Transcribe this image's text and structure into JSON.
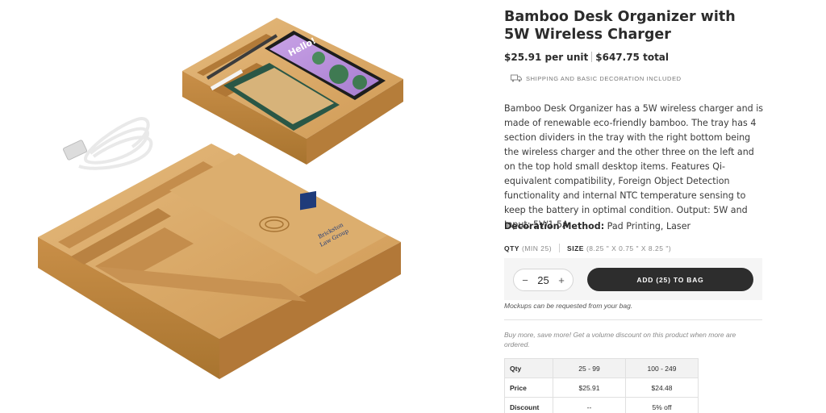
{
  "product": {
    "title": "Bamboo Desk Organizer with 5W Wireless Charger",
    "unit_price": "$25.91 per unit",
    "total_price": "$647.75 total",
    "shipping_note": "SHIPPING AND BASIC DECORATION INCLUDED",
    "description": "Bamboo Desk Organizer has a 5W wireless charger and is made of renewable eco-friendly bamboo. The tray has 4 section dividers in the tray with the right bottom being the wireless charger and the other three on the left and on the top hold small desktop items. Features Qi-equivalent compatibility, Foreign Object Detection functionality and internal NTC temperature sensing to keep the battery in optimal condition. Output: 5W and Input: 5V/1.5A.",
    "decoration_label": "Decoration Method:",
    "decoration_value": "Pad Printing, Laser"
  },
  "specs": {
    "qty_label": "QTY",
    "qty_min": "(MIN 25)",
    "size_label": "SIZE",
    "size_value": "(8.25 \" X 0.75 \" X 8.25 \")"
  },
  "cart": {
    "decrement": "−",
    "quantity": "25",
    "increment": "+",
    "add_button": "ADD (25) TO BAG",
    "mockups_note": "Mockups can be requested from your bag."
  },
  "volume": {
    "note": "Buy more, save more! Get a volume discount on this product when more are ordered.",
    "table": {
      "rows": [
        [
          "Qty",
          "25 - 99",
          "100 - 249"
        ],
        [
          "Price",
          "$25.91",
          "$24.48"
        ],
        [
          "Discount",
          "--",
          "5% off"
        ]
      ]
    }
  },
  "image": {
    "phone_screen_text": "Hello!",
    "logo_text_line1": "Brickston",
    "logo_text_line2": "Law Group"
  },
  "colors": {
    "bamboo": "#d9a96a",
    "bamboo_dark": "#b9853f",
    "button": "#2d2d2d",
    "phone_screen": "#b98fd6"
  },
  "icons": {
    "shipping": "truck-icon",
    "charger": "wireless-charging-icon"
  }
}
